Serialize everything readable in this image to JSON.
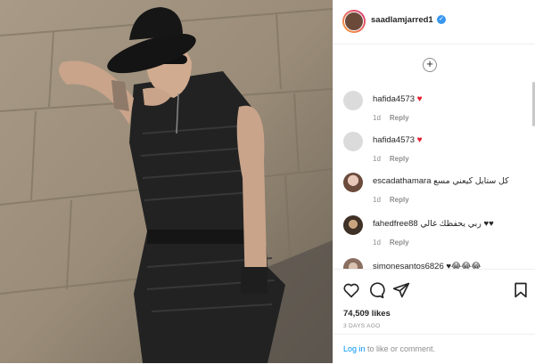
{
  "post": {
    "username": "saadlamjarred1",
    "verified_symbol": "✓",
    "add_symbol": "+"
  },
  "comments": [
    {
      "username": "hafida4573",
      "text": "♥",
      "time": "1d",
      "reply": "Reply"
    },
    {
      "username": "hafida4573",
      "text": "♥",
      "time": "1d",
      "reply": "Reply"
    },
    {
      "username": "escadathamara",
      "text": "كل ستايل كيعني مسع",
      "time": "1d",
      "reply": "Reply"
    },
    {
      "username": "fahedfree88",
      "text": "ربي يحفظك غالي ♥♥",
      "time": "1d",
      "reply": "Reply"
    },
    {
      "username": "simonesantos6826",
      "text": "♥😂😂😂",
      "time": "",
      "reply": ""
    }
  ],
  "actions": {
    "likes_count": "74,509",
    "likes_label": "likes",
    "date": "3 DAYS AGO"
  },
  "login": {
    "login_link": "Log in",
    "suffix": " to like or comment."
  },
  "colors": {
    "accent": "#0095f6",
    "heart": "#e41d2d",
    "verified": "#3897f0"
  }
}
